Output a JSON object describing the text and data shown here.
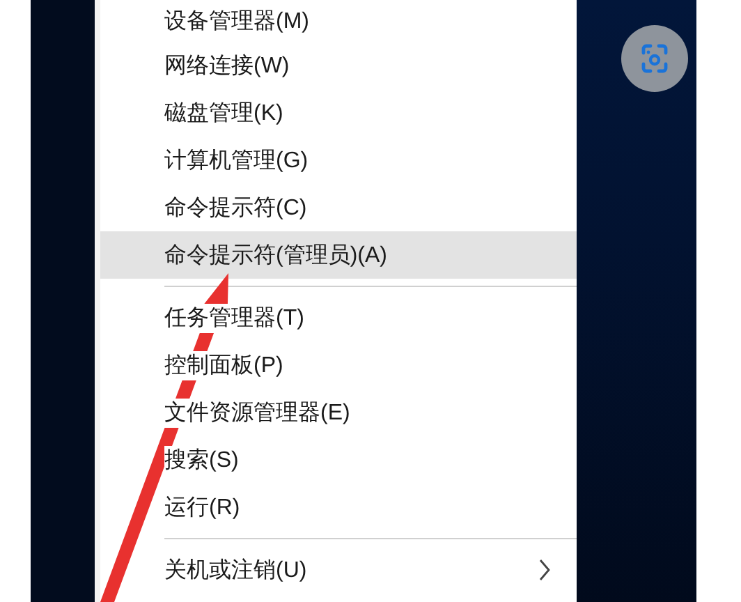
{
  "menu": {
    "items": [
      {
        "kind": "item",
        "label": "设备管理器(M)",
        "selected": false
      },
      {
        "kind": "item",
        "label": "网络连接(W)",
        "selected": false
      },
      {
        "kind": "item",
        "label": "磁盘管理(K)",
        "selected": false
      },
      {
        "kind": "item",
        "label": "计算机管理(G)",
        "selected": false
      },
      {
        "kind": "item",
        "label": "命令提示符(C)",
        "selected": false
      },
      {
        "kind": "item",
        "label": "命令提示符(管理员)(A)",
        "selected": true
      },
      {
        "kind": "separator"
      },
      {
        "kind": "item",
        "label": "任务管理器(T)",
        "selected": false
      },
      {
        "kind": "item",
        "label": "控制面板(P)",
        "selected": false
      },
      {
        "kind": "item",
        "label": "文件资源管理器(E)",
        "selected": false
      },
      {
        "kind": "item",
        "label": "搜索(S)",
        "selected": false
      },
      {
        "kind": "item",
        "label": "运行(R)",
        "selected": false
      },
      {
        "kind": "separator"
      },
      {
        "kind": "submenu",
        "label": "关机或注销(U)",
        "selected": false
      }
    ]
  }
}
